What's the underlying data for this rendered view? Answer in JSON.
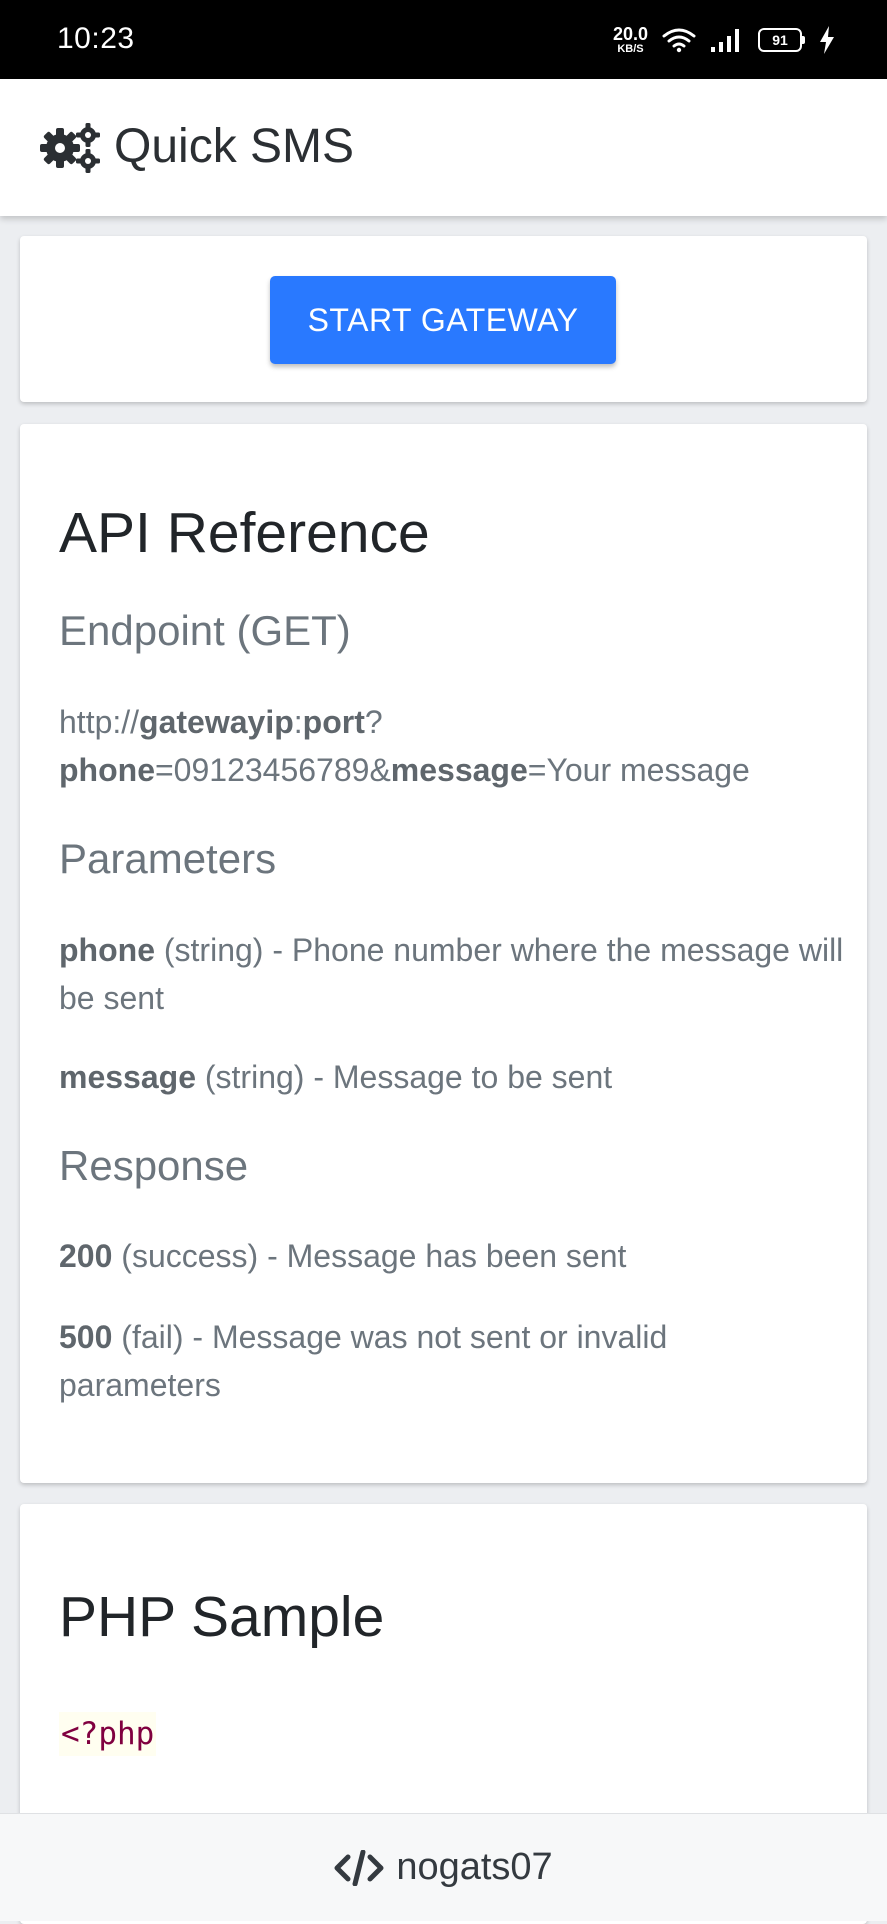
{
  "status_bar": {
    "time": "10:23",
    "speed_value": "20.0",
    "speed_unit": "KB/S",
    "battery": "91"
  },
  "app_bar": {
    "title": "Quick SMS",
    "icon": "gears-icon"
  },
  "gateway": {
    "button_label": "START GATEWAY"
  },
  "api_reference": {
    "title": "API Reference",
    "endpoint_heading": "Endpoint (GET)",
    "endpoint_url": {
      "prefix": "http://",
      "host": "gatewayip",
      "colon": ":",
      "port": "port",
      "question": "?",
      "phone_key": "phone",
      "phone_value": "=09123456789&",
      "message_key": "message",
      "message_value": "=Your message"
    },
    "parameters_heading": "Parameters",
    "parameters": [
      {
        "name": "phone",
        "description": " (string) - Phone number where the message will be sent"
      },
      {
        "name": "message",
        "description": " (string) - Message to be sent"
      }
    ],
    "response_heading": "Response",
    "responses": [
      {
        "code": "200",
        "description": " (success) - Message has been sent"
      },
      {
        "code": "500",
        "description": " (fail) - Message was not sent or invalid parameters"
      }
    ]
  },
  "php_sample": {
    "title": "PHP Sample",
    "code_line": "<?php"
  },
  "footer": {
    "icon": "code-icon",
    "text": "nogats07"
  },
  "colors": {
    "button": "#2979ff",
    "status_bar": "#000000",
    "muted_text": "#6c757d",
    "php_tag": "#800040"
  }
}
